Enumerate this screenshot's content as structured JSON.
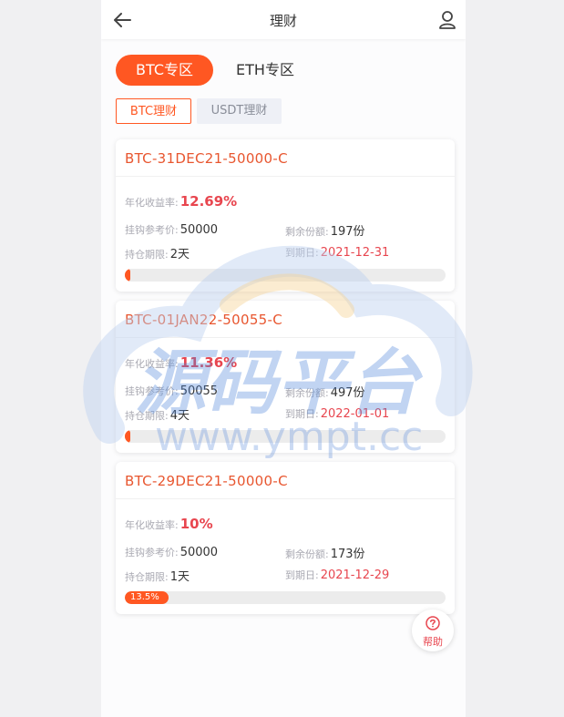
{
  "header": {
    "title": "理财"
  },
  "tabs": [
    {
      "label": "BTC专区",
      "active": true
    },
    {
      "label": "ETH专区",
      "active": false
    }
  ],
  "subtabs": [
    {
      "label": "BTC理财",
      "active": true
    },
    {
      "label": "USDT理财",
      "active": false
    }
  ],
  "labels": {
    "yield": "年化收益率:",
    "ref_price": "挂钩参考价:",
    "remaining": "剩余份额:",
    "term": "持仓期限:",
    "maturity": "到期日:"
  },
  "products": [
    {
      "name": "BTC-31DEC21-50000-C",
      "yield": "12.69%",
      "ref_price": "50000",
      "remaining": "197份",
      "term": "2天",
      "maturity": "2021-12-31",
      "progress_label": "",
      "progress_pct": 1
    },
    {
      "name": "BTC-01JAN22-50055-C",
      "yield": "11.36%",
      "ref_price": "50055",
      "remaining": "497份",
      "term": "4天",
      "maturity": "2022-01-01",
      "progress_label": "",
      "progress_pct": 1
    },
    {
      "name": "BTC-29DEC21-50000-C",
      "yield": "10%",
      "ref_price": "50000",
      "remaining": "173份",
      "term": "1天",
      "maturity": "2021-12-29",
      "progress_label": "13.5%",
      "progress_pct": 13.5
    }
  ],
  "help": {
    "label": "帮助"
  },
  "watermark": {
    "brand": "源码平台",
    "url": "www.ympt.cc"
  },
  "colors": {
    "accent": "#ff5722",
    "title_red": "#e8562f",
    "value_red": "#e8464f"
  }
}
